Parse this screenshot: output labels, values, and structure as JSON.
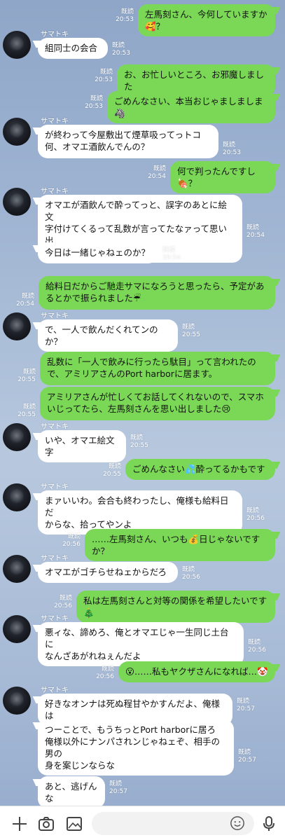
{
  "contact": {
    "name": "サマトキ"
  },
  "read_label": "既読",
  "messages": [
    {
      "side": "out",
      "text": "左馬刻さん、今何していますか🥰？",
      "time": "20:53"
    },
    {
      "side": "in",
      "text": "組同士の会合",
      "time": "20:53"
    },
    {
      "side": "out",
      "text": "お、お忙しいところ、お邪魔しました",
      "time": "20:53"
    },
    {
      "side": "out",
      "text": "ごめんなさい、本当おじゃましましま🦓",
      "time": "20:53"
    },
    {
      "side": "in",
      "text": "が終わって今屋敷出て煙草吸ってっトコ\n何、オマエ酒飲んでんの？",
      "time": "20:53"
    },
    {
      "side": "out",
      "text": "何で判ったんですし🍖？",
      "time": "20:54"
    },
    {
      "side": "in",
      "text": "オマエが酒飲んで酔ってっと、誤字のあとに絵文\n字付けてくるって乱数が言ってたなァって思い出\nしたんだよ",
      "time": "20:54"
    },
    {
      "side": "in",
      "text": "今日は一緒じゃねェのか？",
      "time": "20:54"
    },
    {
      "side": "out",
      "text": "給料日だからご馳走サマになろうと思ったら、予定があ\nるとかで振られました☔",
      "time": "20:54"
    },
    {
      "side": "in",
      "text": "で、一人で飲んだくれてンのか？",
      "time": "20:55"
    },
    {
      "side": "out",
      "text": "乱数に「一人で飲みに行ったら駄目」って言われたの\nで、アミリアさんのPort harborに居ます。",
      "time": "20:55"
    },
    {
      "side": "out",
      "text": "アミリアさんが忙しくてお話してくれないので、スマホ\nいじってたら、左馬刻さんを思い出しました😢",
      "time": "20:55"
    },
    {
      "side": "in",
      "text": "いや、オマエ絵文字",
      "time": "20:55"
    },
    {
      "side": "out",
      "text": "ごめんなさい💦酔ってるかもです",
      "time": "20:55"
    },
    {
      "side": "in",
      "text": "まァいいわ。会合も終わったし、俺様も給料日だ\nからな、拾ってやンよ",
      "time": "20:56"
    },
    {
      "side": "out",
      "text": "……左馬刻さん、いつも💰日じゃないですか？",
      "time": "20:56"
    },
    {
      "side": "in",
      "text": "オマエがゴチらせねェからだろ",
      "time": "20:56"
    },
    {
      "side": "out",
      "text": "私は左馬刻さんと対等の関係を希望したいです🎄",
      "time": "20:56"
    },
    {
      "side": "in",
      "text": "悪ィな、諦めろ、俺とオマエじゃ一生同じ土台に\nなんざあがれねぇんだよ",
      "time": "20:56"
    },
    {
      "side": "out",
      "text": "😮……私もヤクザさんになれば…🤡",
      "time": "20:56"
    },
    {
      "side": "in",
      "text": "好きなオンナは死ぬ程甘やかすんだよ、俺様は",
      "time": "20:57"
    },
    {
      "side": "in",
      "text": "つーことで、もうちっとPort harborに居ろ\n俺様以外にナンパされンじゃねェぞ、相手の男の\n身を案じンならな",
      "time": "20:57"
    },
    {
      "side": "in",
      "text": "あと、逃げんな",
      "time": "20:57"
    }
  ],
  "toolbar": {
    "plus_icon": "plus-icon",
    "camera_icon": "camera-icon",
    "image_icon": "image-icon",
    "emoji_icon": "emoji-icon",
    "mic_icon": "mic-icon"
  }
}
